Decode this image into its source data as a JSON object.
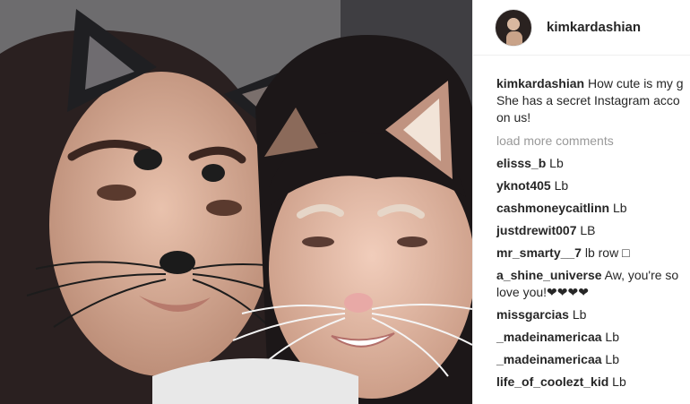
{
  "post": {
    "photo_alt": "Selfie with cat ears filter",
    "owner_username": "kimkardashian"
  },
  "caption": {
    "username": "kimkardashian",
    "line1": "How cute is my g",
    "line2": "She has a secret Instagram acco",
    "line3": "on us!"
  },
  "load_more": "load more comments",
  "comments": [
    {
      "username": "elisss_b",
      "text": "Lb"
    },
    {
      "username": "yknot405",
      "text": "Lb"
    },
    {
      "username": "cashmoneycaitlinn",
      "text": "Lb"
    },
    {
      "username": "justdrewit007",
      "text": "LB"
    },
    {
      "username": "mr_smarty__7",
      "text": "lb row □"
    },
    {
      "username": "a_shine_universe",
      "text": "Aw, you're so",
      "text2": "love you!❤❤❤❤"
    },
    {
      "username": "missgarcias",
      "text": "Lb"
    },
    {
      "username": "_madeinamericaa",
      "text": "Lb"
    },
    {
      "username": "_madeinamericaa",
      "text": "Lb"
    },
    {
      "username": "life_of_coolezt_kid",
      "text": "Lb"
    }
  ]
}
